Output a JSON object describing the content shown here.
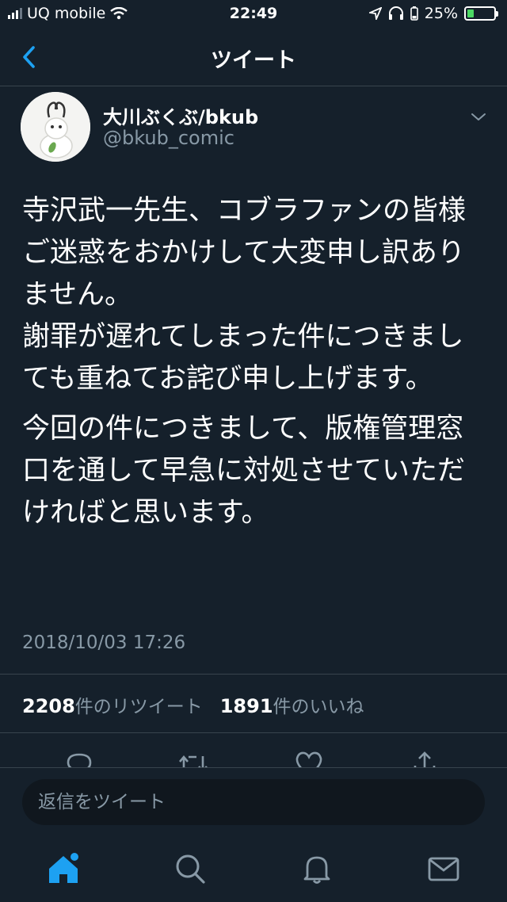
{
  "status_bar": {
    "carrier": "UQ mobile",
    "time": "22:49",
    "battery_percent": "25%",
    "battery_level": 0.25
  },
  "nav": {
    "title": "ツイート"
  },
  "tweet": {
    "author_name": "大川ぶくぶ/bkub",
    "author_handle": "@bkub_comic",
    "paragraphs": [
      "寺沢武一先生、コブラファンの皆様\nご迷惑をおかけして大変申し訳ありません。\n謝罪が遅れてしまった件につきましても重ねてお詫び申し上げます。",
      "今回の件につきまして、版権管理窓口を通して早急に対処させていただければと思います。"
    ],
    "timestamp": "2018/10/03 17:26",
    "retweet_count": "2208",
    "retweet_label": "件のリツイート",
    "like_count": "1891",
    "like_label": "件のいいね"
  },
  "reply": {
    "placeholder": "返信をツイート"
  },
  "colors": {
    "background": "#15202b",
    "accent": "#1da1f2",
    "secondary_text": "#8899a6",
    "divider": "#38444d"
  },
  "icons": {
    "actions": [
      "reply-icon",
      "retweet-icon",
      "like-icon",
      "share-icon"
    ],
    "tabs": [
      "home-icon",
      "search-icon",
      "notifications-icon",
      "messages-icon"
    ]
  }
}
